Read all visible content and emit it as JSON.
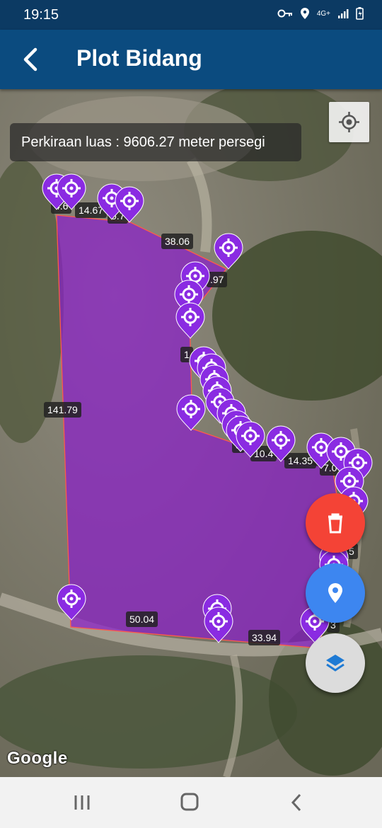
{
  "status_bar": {
    "time": "19:15",
    "network": "4G+",
    "icons": [
      "key-icon",
      "location-icon",
      "signal-icon",
      "battery-icon"
    ]
  },
  "app_bar": {
    "title": "Plot Bidang",
    "back_icon": "back-arrow-icon"
  },
  "map": {
    "area_estimate": "Perkiraan luas : 9606.27 meter persegi",
    "segment_labels": [
      "4.6",
      "14.67",
      "5.7",
      "38.06",
      ".97",
      "1",
      "141.79",
      "5",
      "10.4",
      "14.35",
      "7.0",
      "5",
      "50.04",
      "33.94",
      "3"
    ],
    "attribution": "Google",
    "polygon_color": "#8a1fc9",
    "marker_color": "#8a2be2",
    "marker_count": 30
  },
  "fabs": {
    "delete": {
      "icon": "trash-icon",
      "color": "#f44336"
    },
    "add_point": {
      "icon": "location-pin-icon",
      "color": "#3d86f0"
    },
    "layers": {
      "icon": "layers-icon",
      "color": "#dcdcdc"
    }
  },
  "nav_bar": {
    "buttons": [
      "recent-apps-icon",
      "home-icon",
      "back-icon"
    ]
  }
}
